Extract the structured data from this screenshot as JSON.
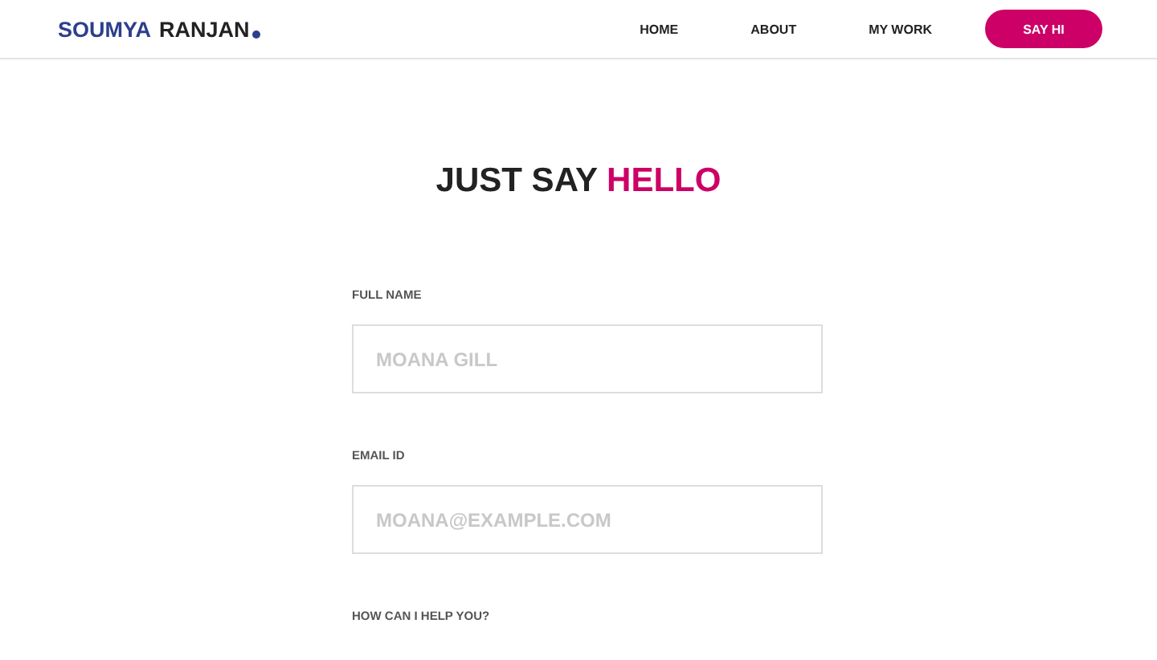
{
  "header": {
    "logo": {
      "first": "SOUMYA",
      "second": "RANJAN"
    },
    "nav": [
      {
        "label": "HOME",
        "kind": "link"
      },
      {
        "label": "ABOUT",
        "kind": "link"
      },
      {
        "label": "MY WORK",
        "kind": "link"
      },
      {
        "label": "SAY HI",
        "kind": "button"
      }
    ]
  },
  "heading": {
    "text": "JUST SAY",
    "highlight": "HELLO"
  },
  "form": {
    "fields": [
      {
        "label": "FULL NAME",
        "placeholder": "MOANA GILL",
        "kind": "input"
      },
      {
        "label": "EMAIL ID",
        "placeholder": "MOANA@EXAMPLE.COM",
        "kind": "input"
      },
      {
        "label": "HOW CAN I HELP YOU?",
        "kind": "label-only"
      }
    ]
  }
}
